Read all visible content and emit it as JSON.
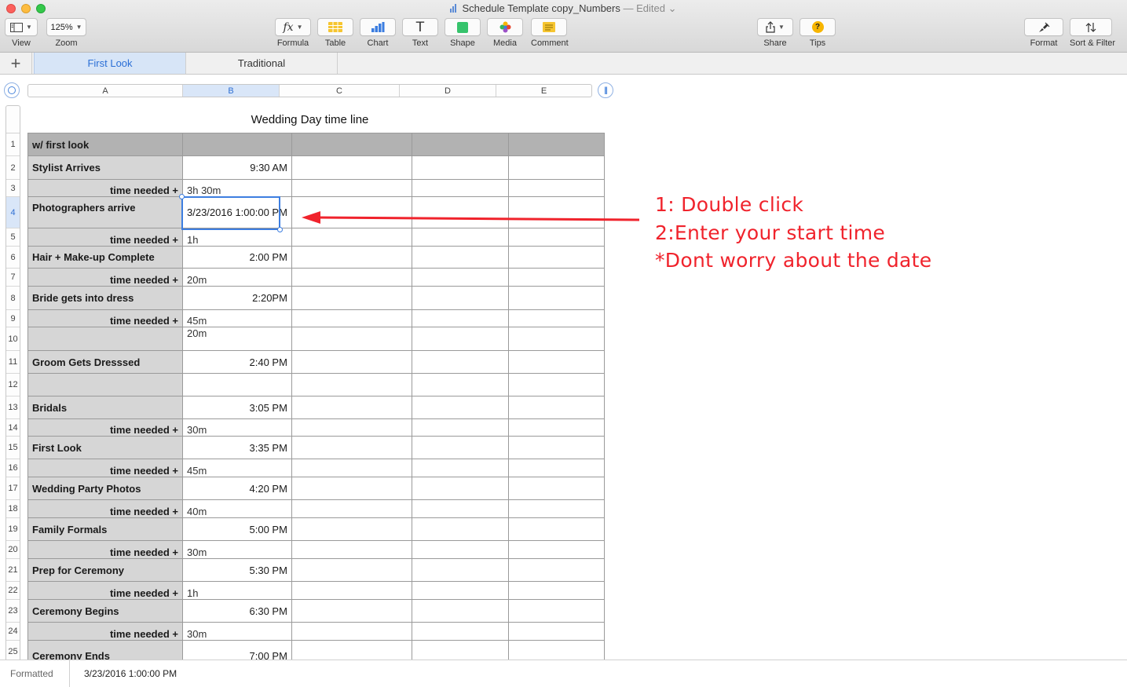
{
  "window": {
    "title": "Schedule Template copy_Numbers",
    "edited": "— Edited",
    "edited_chevron": "⌄"
  },
  "toolbar": {
    "view_label": "View",
    "zoom_value": "125%",
    "zoom_label": "Zoom",
    "formula_icon": "fx",
    "formula_label": "Formula",
    "table_label": "Table",
    "chart_label": "Chart",
    "text_icon": "T",
    "text_label": "Text",
    "shape_label": "Shape",
    "media_label": "Media",
    "comment_label": "Comment",
    "share_label": "Share",
    "tips_icon": "?",
    "tips_label": "Tips",
    "format_label": "Format",
    "sort_label": "Sort & Filter"
  },
  "tabs": {
    "add": "+",
    "items": [
      "First Look",
      "Traditional"
    ]
  },
  "columns": [
    "A",
    "B",
    "C",
    "D",
    "E"
  ],
  "rows": [
    "1",
    "2",
    "3",
    "4",
    "5",
    "6",
    "7",
    "8",
    "9",
    "10",
    "11",
    "12",
    "13",
    "14",
    "15",
    "16",
    "17",
    "18",
    "19",
    "20",
    "21",
    "22",
    "23",
    "24",
    "25"
  ],
  "sheet": {
    "title": "Wedding Day time line",
    "header_label": "w/ first look",
    "needed_label": "time needed +",
    "events": [
      {
        "label": "Stylist Arrives",
        "time": "9:30 AM",
        "needed": "3h 30m"
      },
      {
        "label": "Photographers arrive",
        "time": "3/23/2016 1:00:00 PM",
        "needed": "1h"
      },
      {
        "label": "Hair + Make-up Complete",
        "time": "2:00 PM",
        "needed": "20m"
      },
      {
        "label": "Bride gets into dress",
        "time": "2:20PM",
        "needed": "45m"
      },
      {
        "extra": "20m"
      },
      {
        "label": "Groom Gets Dresssed",
        "time": "2:40 PM"
      },
      {
        "label": "Bridals",
        "time": "3:05 PM",
        "needed": "30m"
      },
      {
        "label": "First Look",
        "time": "3:35 PM",
        "needed": "45m"
      },
      {
        "label": "Wedding Party Photos",
        "time": "4:20 PM",
        "needed": "40m"
      },
      {
        "label": "Family Formals",
        "time": "5:00 PM",
        "needed": "30m"
      },
      {
        "label": "Prep for Ceremony",
        "time": "5:30 PM",
        "needed": "1h"
      },
      {
        "label": "Ceremony Begins",
        "time": "6:30 PM",
        "needed": "30m"
      },
      {
        "label": "Ceremony Ends",
        "time": "7:00 PM"
      }
    ]
  },
  "annotation": {
    "line1": "1: Double click",
    "line2": "2:Enter your start time",
    "line3": "*Dont worry about the date",
    "color": "#f0232c"
  },
  "status": {
    "label": "Formatted",
    "value": "3/23/2016 1:00:00 PM"
  }
}
